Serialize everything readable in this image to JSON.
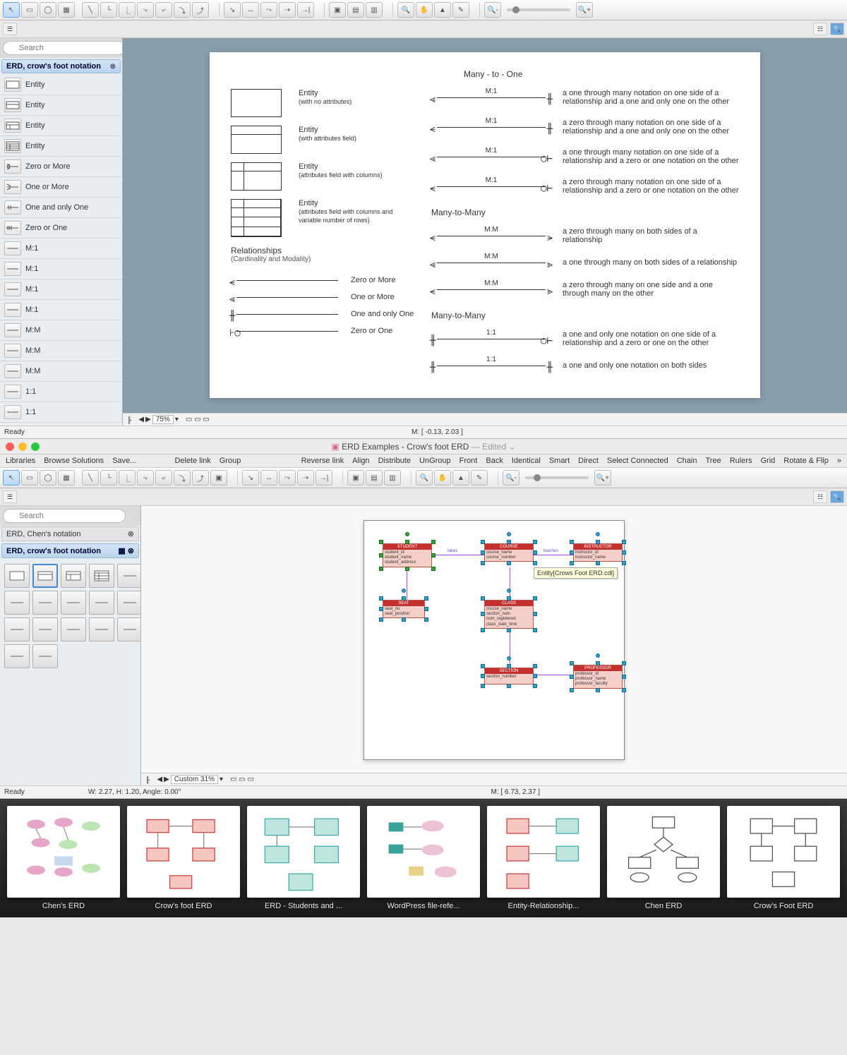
{
  "top_window": {
    "search_placeholder": "Search",
    "panel_title": "ERD, crow's foot notation",
    "shapes": [
      "Entity",
      "Entity",
      "Entity",
      "Entity",
      "Zero or More",
      "One or More",
      "One and only One",
      "Zero or One",
      "M:1",
      "M:1",
      "M:1",
      "M:1",
      "M:M",
      "M:M",
      "M:M",
      "1:1",
      "1:1"
    ],
    "status_ready": "Ready",
    "status_zoom": "75%",
    "status_coords": "M: [ -0.13, 2.03 ]",
    "doc": {
      "heading_m1": "Many - to - One",
      "heading_mm": "Many-to-Many",
      "heading_mm2": "Many-to-Many",
      "ent1_t": "Entity",
      "ent1_s": "(with no attributes)",
      "ent2_t": "Entity",
      "ent2_s": "(with attributes field)",
      "ent3_t": "Entity",
      "ent3_s": "(attributes field with columns)",
      "ent4_t": "Entity",
      "ent4_s": "(attributes field with columns and variable number of rows)",
      "rel_hdr": "Relationships",
      "rel_sub": "(Cardinality and Modality)",
      "simp1": "Zero or More",
      "simp2": "One or More",
      "simp3": "One and only One",
      "simp4": "Zero or One",
      "m1a": "a one through many notation on one side of a relationship and a one and only one on the other",
      "m1b": "a zero through many notation on one side of a relationship and a one and only one on the other",
      "m1c": "a one through many notation on one side of a relationship and a zero or one notation on the other",
      "m1d": "a zero through many notation on one side of a relationship and a zero or one notation on the other",
      "mma": "a zero through many on both sides of a relationship",
      "mmb": "a one through many on both sides of a relationship",
      "mmc": "a zero through many on one side and a one through many on the other",
      "o1a": "a one and only one notation on one side of a relationship and a zero or one on the other",
      "o1b": "a one and only one notation on both sides",
      "lab_m1": "M:1",
      "lab_mm": "M:M",
      "lab_11": "1:1"
    }
  },
  "bottom_window": {
    "title": "ERD Examples - Crow's foot ERD",
    "edited": "— Edited",
    "menus_left": [
      "Libraries",
      "Browse Solutions",
      "Save..."
    ],
    "menus_right": [
      "Delete link",
      "Group",
      "Reverse link",
      "Align",
      "Distribute",
      "UnGroup",
      "Front",
      "Back",
      "Identical",
      "Smart",
      "Direct",
      "Select Connected",
      "Chain",
      "Tree",
      "Rulers",
      "Grid",
      "Rotate & Flip"
    ],
    "panels": [
      "ERD, Chen's notation",
      "ERD, crow's foot notation"
    ],
    "search_placeholder": "Search",
    "tooltip": "Entity[Crows Foot ERD.cdl]",
    "status_ready": "Ready",
    "status_zoom": "Custom 31%",
    "status_dims": "W: 2.27,  H: 1.20,  Angle: 0.00°",
    "status_coords": "M: [ 6.73, 2.37 ]",
    "entities": {
      "student": {
        "name": "STUDENT",
        "attrs": "student_id\nstudent_name\nstudent_address"
      },
      "course": {
        "name": "COURSE",
        "attrs": "course_name\ncourse_number"
      },
      "instructor": {
        "name": "INSTRUCTOR",
        "attrs": "instructor_id\ninstructor_name"
      },
      "seat": {
        "name": "SEAT",
        "attrs": "seat_no\nseat_position"
      },
      "class": {
        "name": "CLASS",
        "attrs": "course_name\nsection_num\nnum_registered\nclass_date_time"
      },
      "section": {
        "name": "SECTION",
        "attrs": "section_number"
      },
      "professor": {
        "name": "PROFESSOR",
        "attrs": "professor_id\nprofessor_name\nprofessor_faculty"
      },
      "rel_takes": "takes",
      "rel_teaches": "teaches"
    }
  },
  "thumbnails": [
    "Chen's ERD",
    "Crow's foot ERD",
    "ERD - Students and ...",
    "WordPress file-refe...",
    "Entity-Relationship...",
    "Chen ERD",
    "Crow's Foot ERD"
  ]
}
